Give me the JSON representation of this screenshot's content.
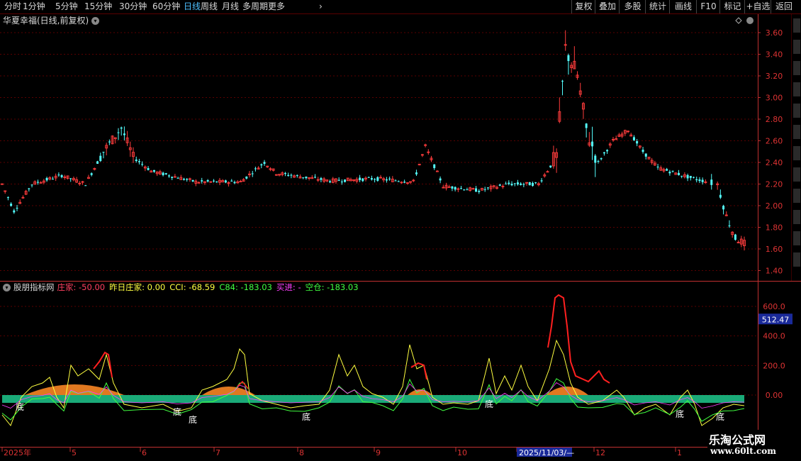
{
  "toolbar": {
    "periods": [
      {
        "label": "分时",
        "active": false
      },
      {
        "label": "1分钟",
        "active": false
      },
      {
        "label": "5分钟",
        "active": false
      },
      {
        "label": "15分钟",
        "active": false
      },
      {
        "label": "30分钟",
        "active": false
      },
      {
        "label": "60分钟",
        "active": false
      },
      {
        "label": "日线",
        "active": true
      },
      {
        "label": "周线",
        "active": false
      },
      {
        "label": "月线",
        "active": false
      },
      {
        "label": "多周期",
        "active": false
      },
      {
        "label": "更多",
        "active": false
      }
    ],
    "right_buttons": [
      "复权",
      "叠加",
      "多股",
      "统计",
      "画线",
      "F10",
      "标记",
      "+自选",
      "返回"
    ]
  },
  "main_chart": {
    "title": "华夏幸福(日线,前复权)",
    "price_axis": [
      "3.60",
      "3.40",
      "3.20",
      "3.00",
      "2.80",
      "2.60",
      "2.40",
      "2.20",
      "2.00",
      "1.80",
      "1.60",
      "1.40"
    ],
    "colors": {
      "up": "#ff3c3c",
      "down": "#54ffff",
      "grid": "#5a0000",
      "axis": "#c03030"
    }
  },
  "indicator": {
    "name": "股朋指标网",
    "fields": [
      {
        "label": "庄家: ",
        "value": "-50.00",
        "color": "#ff4060"
      },
      {
        "label": "昨日庄家: ",
        "value": "0.00",
        "color": "#ffff40"
      },
      {
        "label": "CCI: ",
        "value": "-68.59",
        "color": "#ffff40"
      },
      {
        "label": "C84: ",
        "value": "-183.03",
        "color": "#40ff40"
      },
      {
        "label": "买进: ",
        "value": "-",
        "color": "#ff40ff"
      },
      {
        "label": "空仓: ",
        "value": "-183.03",
        "color": "#40ff40"
      }
    ],
    "axis": [
      "600.0",
      "400.0",
      "200.0",
      "0.00"
    ],
    "current_value": "512.47",
    "bottom_label": "底",
    "colors": {
      "band": "#1aaa78",
      "hill": "#e07820",
      "cci": "#ffff40",
      "zhuang": "#ff2020",
      "c84": "#40ff40"
    }
  },
  "time_axis": [
    "2025年",
    "5",
    "6",
    "7",
    "8",
    "9",
    "10",
    "11",
    "12",
    "1"
  ],
  "time_cursor": "2025/11/03/—",
  "watermark": {
    "line1": "乐淘公式网",
    "line2": "www.60lt.com"
  }
}
